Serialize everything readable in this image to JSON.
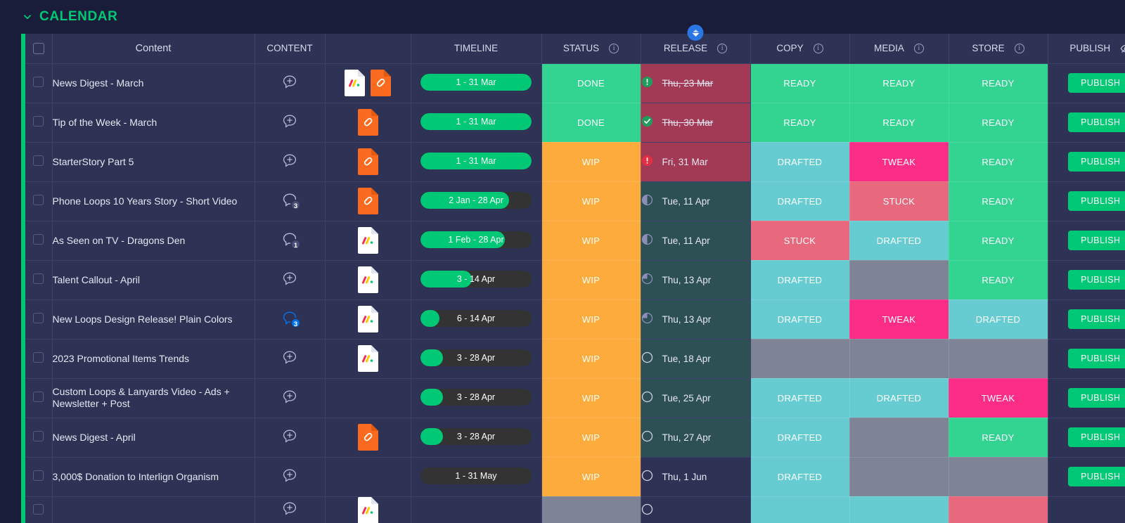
{
  "board": {
    "title": "CALENDAR",
    "collapse_icon": "chevron-down-icon",
    "accent_color": "#00c875"
  },
  "columns": [
    {
      "key": "check",
      "label": "",
      "icon": "checkbox-icon",
      "info": false
    },
    {
      "key": "name",
      "label": "Content",
      "info": false
    },
    {
      "key": "content",
      "label": "CONTENT",
      "info": false
    },
    {
      "key": "file",
      "label": "",
      "info": false
    },
    {
      "key": "time",
      "label": "TIMELINE",
      "info": false
    },
    {
      "key": "status",
      "label": "STATUS",
      "info": true,
      "icon": "info-icon"
    },
    {
      "key": "release",
      "label": "RELEASE",
      "info": true,
      "icon": "info-icon",
      "sort_icon": "sort-asc-desc-icon"
    },
    {
      "key": "copy",
      "label": "COPY",
      "info": true,
      "icon": "info-icon"
    },
    {
      "key": "media",
      "label": "MEDIA",
      "info": true,
      "icon": "info-icon"
    },
    {
      "key": "store",
      "label": "STORE",
      "info": true,
      "icon": "info-icon"
    },
    {
      "key": "publish",
      "label": "PUBLISH",
      "info": false,
      "icon": "eye-off-icon"
    }
  ],
  "colors": {
    "done_green": "#33d391",
    "wip_orange": "#fdab3d",
    "ready_green": "#33d391",
    "drafted_teal": "#66ccd1",
    "tweak_pink": "#fb2d87",
    "stuck_red": "#e8697d",
    "empty_gray": "#7e8396",
    "overdue_bg": "#a23a56",
    "upcoming_bg": "#2d5055",
    "row_bg": "#2e3355",
    "timeline_track": "#333333",
    "timeline_fill": "#00c875",
    "publish_green": "#00c875"
  },
  "publish_label": "PUBLISH",
  "rows": [
    {
      "name": "News Digest - March",
      "comment": {
        "type": "add",
        "count": null
      },
      "files": [
        "monday-doc-icon",
        "link-doc-icon"
      ],
      "timeline": {
        "label": "1 - 31 Mar",
        "progress": 100
      },
      "status": {
        "label": "DONE",
        "color": "#33d391"
      },
      "release": {
        "date": "Thu, 23 Mar",
        "strike": true,
        "bg": "#a23a56",
        "marker": "alert-green-icon"
      },
      "copy": {
        "label": "READY",
        "color": "#33d391"
      },
      "media": {
        "label": "READY",
        "color": "#33d391"
      },
      "store": {
        "label": "READY",
        "color": "#33d391"
      }
    },
    {
      "name": "Tip of the Week - March",
      "comment": {
        "type": "add",
        "count": null
      },
      "files": [
        "link-doc-icon"
      ],
      "timeline": {
        "label": "1 - 31 Mar",
        "progress": 100
      },
      "status": {
        "label": "DONE",
        "color": "#33d391"
      },
      "release": {
        "date": "Thu, 30 Mar",
        "strike": true,
        "bg": "#a23a56",
        "marker": "check-green-icon"
      },
      "copy": {
        "label": "READY",
        "color": "#33d391"
      },
      "media": {
        "label": "READY",
        "color": "#33d391"
      },
      "store": {
        "label": "READY",
        "color": "#33d391"
      }
    },
    {
      "name": "StarterStory Part 5",
      "comment": {
        "type": "add",
        "count": null
      },
      "files": [
        "link-doc-icon"
      ],
      "timeline": {
        "label": "1 - 31 Mar",
        "progress": 100
      },
      "status": {
        "label": "WIP",
        "color": "#fdab3d"
      },
      "release": {
        "date": "Fri, 31 Mar",
        "strike": false,
        "bg": "#a23a56",
        "marker": "alert-red-icon"
      },
      "copy": {
        "label": "DRAFTED",
        "color": "#66ccd1"
      },
      "media": {
        "label": "TWEAK",
        "color": "#fb2d87"
      },
      "store": {
        "label": "READY",
        "color": "#33d391"
      }
    },
    {
      "name": "Phone Loops 10 Years Story - Short Video",
      "comment": {
        "type": "count",
        "count": "3",
        "badge": "gray"
      },
      "files": [
        "link-doc-icon"
      ],
      "timeline": {
        "label": "2 Jan - 28 Apr",
        "progress": 80
      },
      "status": {
        "label": "WIP",
        "color": "#fdab3d"
      },
      "release": {
        "date": "Tue, 11 Apr",
        "strike": false,
        "bg": "#2d5055",
        "marker": "half-circle-icon"
      },
      "copy": {
        "label": "DRAFTED",
        "color": "#66ccd1"
      },
      "media": {
        "label": "STUCK",
        "color": "#e8697d"
      },
      "store": {
        "label": "READY",
        "color": "#33d391"
      }
    },
    {
      "name": "As Seen on TV - Dragons Den",
      "comment": {
        "type": "count",
        "count": "1",
        "badge": "gray"
      },
      "files": [
        "monday-doc-icon"
      ],
      "timeline": {
        "label": "1 Feb - 28 Apr",
        "progress": 76
      },
      "status": {
        "label": "WIP",
        "color": "#fdab3d"
      },
      "release": {
        "date": "Tue, 11 Apr",
        "strike": false,
        "bg": "#2d5055",
        "marker": "half-circle-icon"
      },
      "copy": {
        "label": "STUCK",
        "color": "#e8697d"
      },
      "media": {
        "label": "DRAFTED",
        "color": "#66ccd1"
      },
      "store": {
        "label": "READY",
        "color": "#33d391"
      }
    },
    {
      "name": "Talent Callout - April",
      "comment": {
        "type": "add",
        "count": null
      },
      "files": [
        "monday-doc-icon"
      ],
      "timeline": {
        "label": "3 - 14 Apr",
        "progress": 46
      },
      "status": {
        "label": "WIP",
        "color": "#fdab3d"
      },
      "release": {
        "date": "Thu, 13 Apr",
        "strike": false,
        "bg": "#2d5055",
        "marker": "quarter-circle-icon"
      },
      "copy": {
        "label": "DRAFTED",
        "color": "#66ccd1"
      },
      "media": {
        "label": "",
        "color": "#7e8396"
      },
      "store": {
        "label": "READY",
        "color": "#33d391"
      }
    },
    {
      "name": "New Loops Design Release! Plain Colors",
      "comment": {
        "type": "count",
        "count": "3",
        "badge": "blue"
      },
      "files": [
        "monday-doc-icon"
      ],
      "timeline": {
        "label": "6 - 14 Apr",
        "progress": 17
      },
      "status": {
        "label": "WIP",
        "color": "#fdab3d"
      },
      "release": {
        "date": "Thu, 13 Apr",
        "strike": false,
        "bg": "#2d5055",
        "marker": "quarter-circle-icon"
      },
      "copy": {
        "label": "DRAFTED",
        "color": "#66ccd1"
      },
      "media": {
        "label": "TWEAK",
        "color": "#fb2d87"
      },
      "store": {
        "label": "DRAFTED",
        "color": "#66ccd1"
      }
    },
    {
      "name": "2023 Promotional Items Trends",
      "comment": {
        "type": "add",
        "count": null
      },
      "files": [
        "monday-doc-icon"
      ],
      "timeline": {
        "label": "3 - 28 Apr",
        "progress": 20
      },
      "status": {
        "label": "WIP",
        "color": "#fdab3d"
      },
      "release": {
        "date": "Tue, 18 Apr",
        "strike": false,
        "bg": "#2d5055",
        "marker": "empty-circle-icon"
      },
      "copy": {
        "label": "",
        "color": "#7e8396"
      },
      "media": {
        "label": "",
        "color": "#7e8396"
      },
      "store": {
        "label": "",
        "color": "#7e8396"
      }
    },
    {
      "name": "Custom Loops & Lanyards Video - Ads + Newsletter + Post",
      "comment": {
        "type": "add",
        "count": null
      },
      "files": [],
      "timeline": {
        "label": "3 - 28 Apr",
        "progress": 20
      },
      "status": {
        "label": "WIP",
        "color": "#fdab3d"
      },
      "release": {
        "date": "Tue, 25 Apr",
        "strike": false,
        "bg": "#2d5055",
        "marker": "empty-circle-icon"
      },
      "copy": {
        "label": "DRAFTED",
        "color": "#66ccd1"
      },
      "media": {
        "label": "DRAFTED",
        "color": "#66ccd1"
      },
      "store": {
        "label": "TWEAK",
        "color": "#fb2d87"
      }
    },
    {
      "name": "News Digest - April",
      "comment": {
        "type": "add",
        "count": null
      },
      "files": [
        "link-doc-icon"
      ],
      "timeline": {
        "label": "3 - 28 Apr",
        "progress": 20
      },
      "status": {
        "label": "WIP",
        "color": "#fdab3d"
      },
      "release": {
        "date": "Thu, 27 Apr",
        "strike": false,
        "bg": "#2d5055",
        "marker": "empty-circle-icon"
      },
      "copy": {
        "label": "DRAFTED",
        "color": "#66ccd1"
      },
      "media": {
        "label": "",
        "color": "#7e8396"
      },
      "store": {
        "label": "READY",
        "color": "#33d391"
      }
    },
    {
      "name": "3,000$ Donation to Interlign Organism",
      "comment": {
        "type": "add",
        "count": null
      },
      "files": [],
      "timeline": {
        "label": "1 - 31 May",
        "progress": 0
      },
      "status": {
        "label": "WIP",
        "color": "#fdab3d"
      },
      "release": {
        "date": "Thu, 1 Jun",
        "strike": false,
        "bg": "#2e3355",
        "marker": "empty-circle-icon"
      },
      "copy": {
        "label": "DRAFTED",
        "color": "#66ccd1"
      },
      "media": {
        "label": "",
        "color": "#7e8396"
      },
      "store": {
        "label": "",
        "color": "#7e8396"
      }
    },
    {
      "name": "",
      "partial": true,
      "comment": {
        "type": "add",
        "count": null
      },
      "files": [
        "monday-doc-icon"
      ],
      "timeline": {
        "label": "",
        "progress": 0
      },
      "status": {
        "label": "",
        "color": "#7e8396"
      },
      "release": {
        "date": "",
        "strike": false,
        "bg": "#2e3355",
        "marker": "empty-circle-icon"
      },
      "copy": {
        "label": "",
        "color": "#66ccd1"
      },
      "media": {
        "label": "",
        "color": "#66ccd1"
      },
      "store": {
        "label": "",
        "color": "#e8697d"
      }
    }
  ]
}
